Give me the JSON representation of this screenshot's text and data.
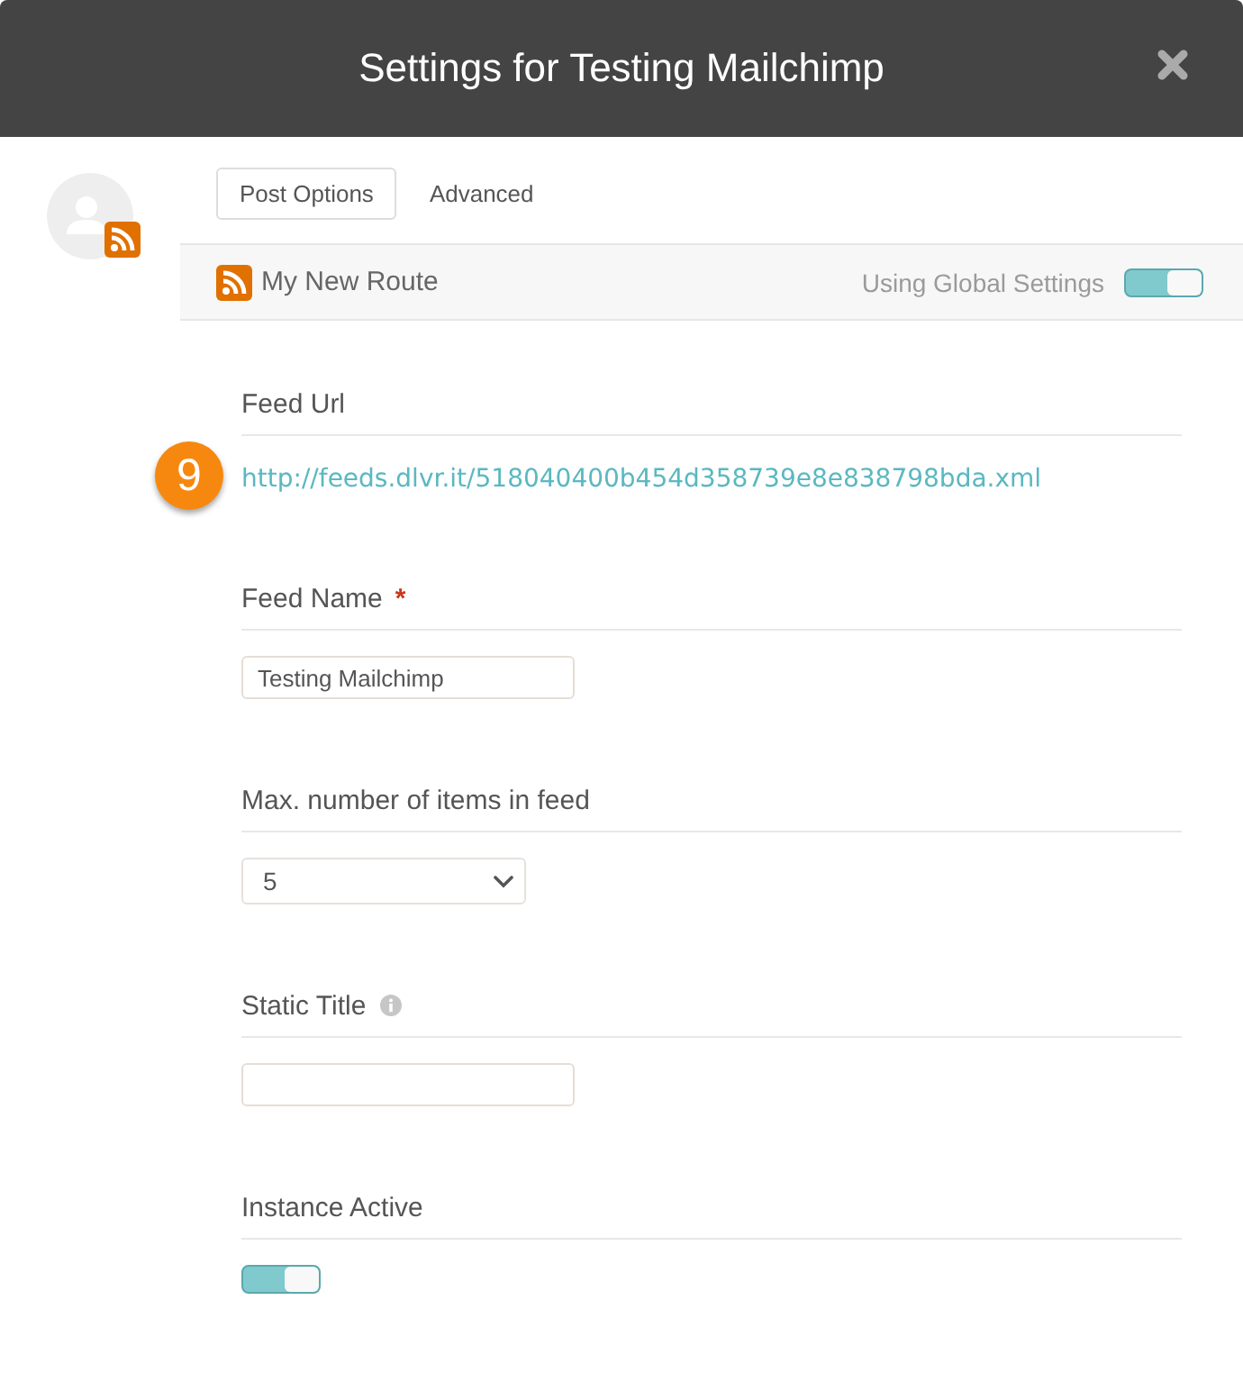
{
  "dialog": {
    "title": "Settings for Testing Mailchimp"
  },
  "tabs": [
    {
      "label": "Post Options",
      "selected": true
    },
    {
      "label": "Advanced",
      "selected": false
    }
  ],
  "route": {
    "name": "My New Route",
    "global_label": "Using Global Settings",
    "global_on": true
  },
  "fields": [
    {
      "kind": "link",
      "label": "Feed Url",
      "value": "http://feeds.dlvr.it/518040400b454d358739e8e838798bda.xml",
      "marker": "9"
    },
    {
      "kind": "text",
      "label": "Feed Name",
      "required_mark": "*",
      "value": "Testing Mailchimp"
    },
    {
      "kind": "select",
      "label": "Max. number of items in feed",
      "value": "5"
    },
    {
      "kind": "text",
      "label": "Static Title",
      "info": true
    },
    {
      "kind": "toggle",
      "label": "Instance Active",
      "on": true
    }
  ]
}
